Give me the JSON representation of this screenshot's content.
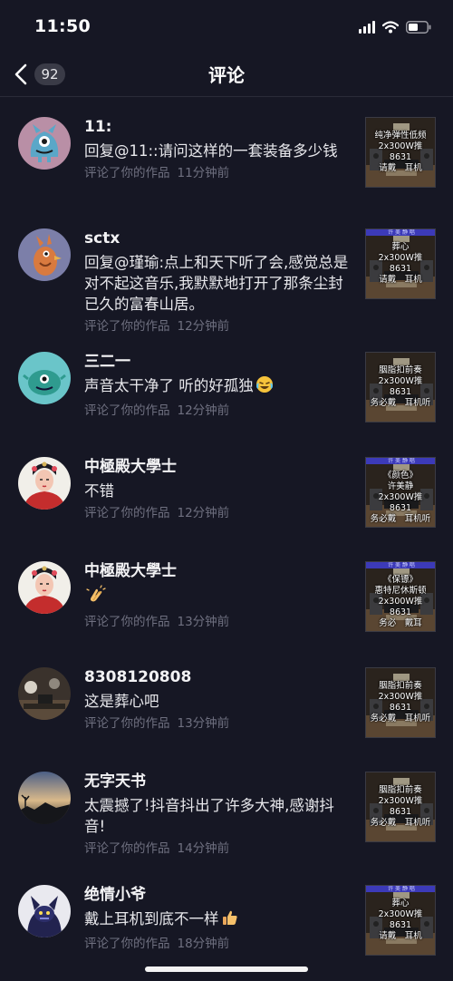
{
  "status_bar": {
    "time": "11:50"
  },
  "header": {
    "title": "评论",
    "back_count": "92"
  },
  "comments": [
    {
      "username": "11:",
      "text": "回复@11::请问这样的一套装备多少钱",
      "action": "评论了你的作品",
      "time": "11分钟前",
      "avatar": "blue-creature",
      "thumb_caption": "纯净弹性低频\n2x300W推8631\n请戴　耳机",
      "thumb_banner": ""
    },
    {
      "username": "sctx",
      "text": "回复@瑾瑜:点上和天下听了会,感觉总是对不起这音乐,我默默地打开了那条尘封已久的富春山居。",
      "action": "评论了你的作品",
      "time": "12分钟前",
      "avatar": "orange-bird",
      "thumb_caption": "葬心\n2x300W推8631\n请戴　耳机",
      "thumb_banner": "许 美 静 唱"
    },
    {
      "username": "三二一",
      "text": "声音太干净了 听的好孤独",
      "emoji": "laugh-cry",
      "action": "评论了你的作品",
      "time": "12分钟前",
      "avatar": "teal-creature",
      "thumb_caption": "胭脂扣前奏\n2x300W推8631\n务必戴　耳机听",
      "thumb_banner": ""
    },
    {
      "username": "中極殿大學士",
      "text": "不错",
      "action": "评论了你的作品",
      "time": "12分钟前",
      "avatar": "opera-portrait",
      "thumb_caption": "《颜色》\n许美静\n2x300W推8631\n务必戴　耳机听",
      "thumb_banner": "许 美 静 唱"
    },
    {
      "username": "中極殿大學士",
      "text": "",
      "emoji": "clap",
      "action": "评论了你的作品",
      "time": "13分钟前",
      "avatar": "opera-portrait",
      "thumb_caption": "《保镖》\n惠特尼休斯顿\n2x300W推8631\n务必　戴耳",
      "thumb_banner": "许 美 静 唱"
    },
    {
      "username": "8308120808",
      "text": "这是葬心吧",
      "action": "评论了你的作品",
      "time": "13分钟前",
      "avatar": "studio-photo",
      "thumb_caption": "胭脂扣前奏\n2x300W推8631\n务必戴　耳机听",
      "thumb_banner": ""
    },
    {
      "username": "无字天书",
      "text": "太震撼了!抖音抖出了许多大神,感谢抖音!",
      "action": "评论了你的作品",
      "time": "14分钟前",
      "avatar": "sunset-photo",
      "thumb_caption": "胭脂扣前奏\n2x300W推8631\n务必戴　耳机听",
      "thumb_banner": ""
    },
    {
      "username": "绝情小爷",
      "text": "戴上耳机到底不一样",
      "emoji": "thumbs-up",
      "action": "评论了你的作品",
      "time": "18分钟前",
      "avatar": "dark-character",
      "thumb_caption": "葬心\n2x300W推8631\n请戴　耳机",
      "thumb_banner": "许 美 静 唱"
    }
  ]
}
